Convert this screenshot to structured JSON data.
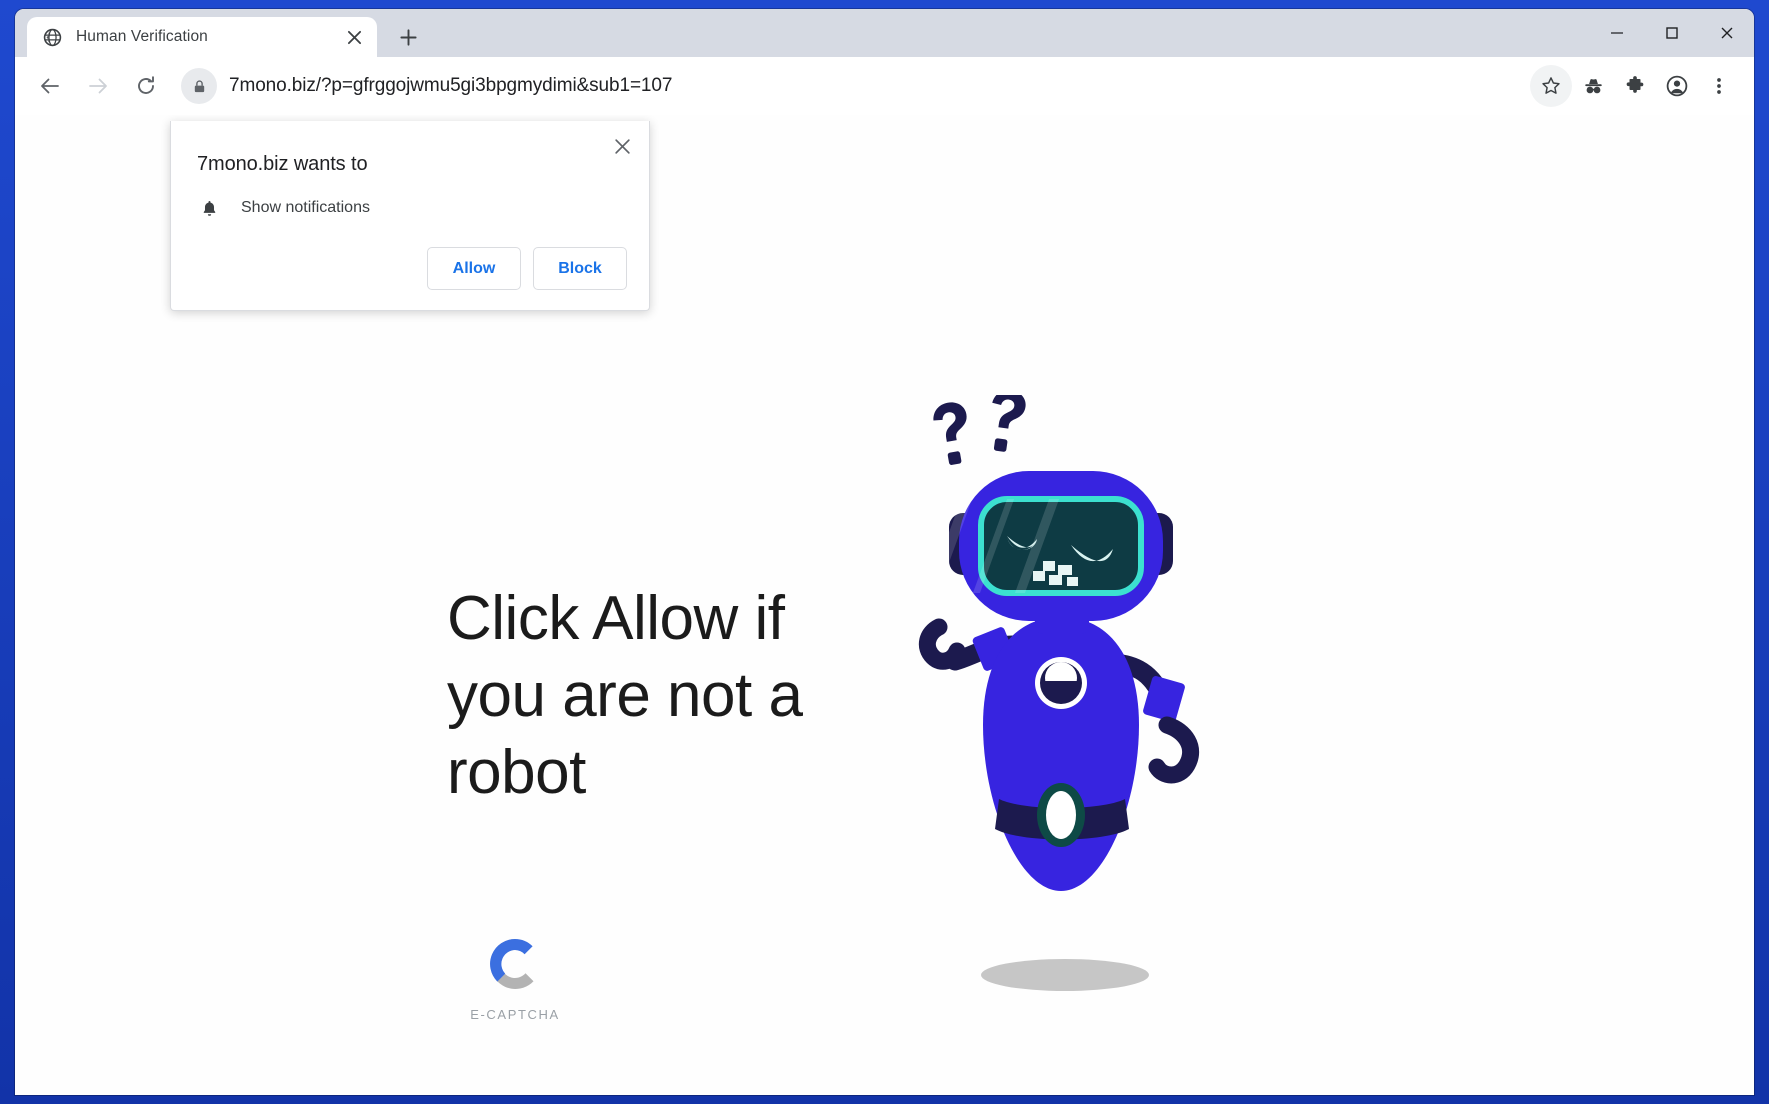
{
  "window": {
    "controls": {
      "minimize": "minimize-window",
      "maximize": "maximize-window",
      "close": "close-window"
    }
  },
  "tabs": [
    {
      "title": "Human Verification",
      "favicon": "globe-icon",
      "close": "close-tab"
    }
  ],
  "newtab_label": "New tab",
  "toolbar": {
    "back": "back-arrow",
    "forward": "forward-arrow",
    "reload": "reload-icon",
    "lock": "lock-icon",
    "url": "7mono.biz/?p=gfrggojwmu5gi3bpgmydimi&sub1=107",
    "bookmark": "star-icon",
    "incognito": "incognito-icon",
    "extensions": "puzzle-icon",
    "profile": "avatar-icon",
    "menu": "three-dot-menu-icon"
  },
  "permission_bubble": {
    "title": "7mono.biz wants to",
    "permission_icon": "bell-icon",
    "permission_label": "Show notifications",
    "allow_label": "Allow",
    "block_label": "Block",
    "close_label": "×"
  },
  "page": {
    "headline": "Click Allow if you are not a robot",
    "captcha_label": "E-CAPTCHA",
    "robot_alt": "confused-robot-illustration",
    "question_marks": "??"
  },
  "colors": {
    "accent_blue": "#1a73e8",
    "robot_body": "#3724e0",
    "robot_dark": "#1c1a4e",
    "robot_screen": "#0e3b44",
    "robot_screen_border": "#3ce0d0",
    "captcha_blue": "#3b6fe0",
    "captcha_gray": "#b3b3b3",
    "desktop_blue": "#1f49cf"
  }
}
